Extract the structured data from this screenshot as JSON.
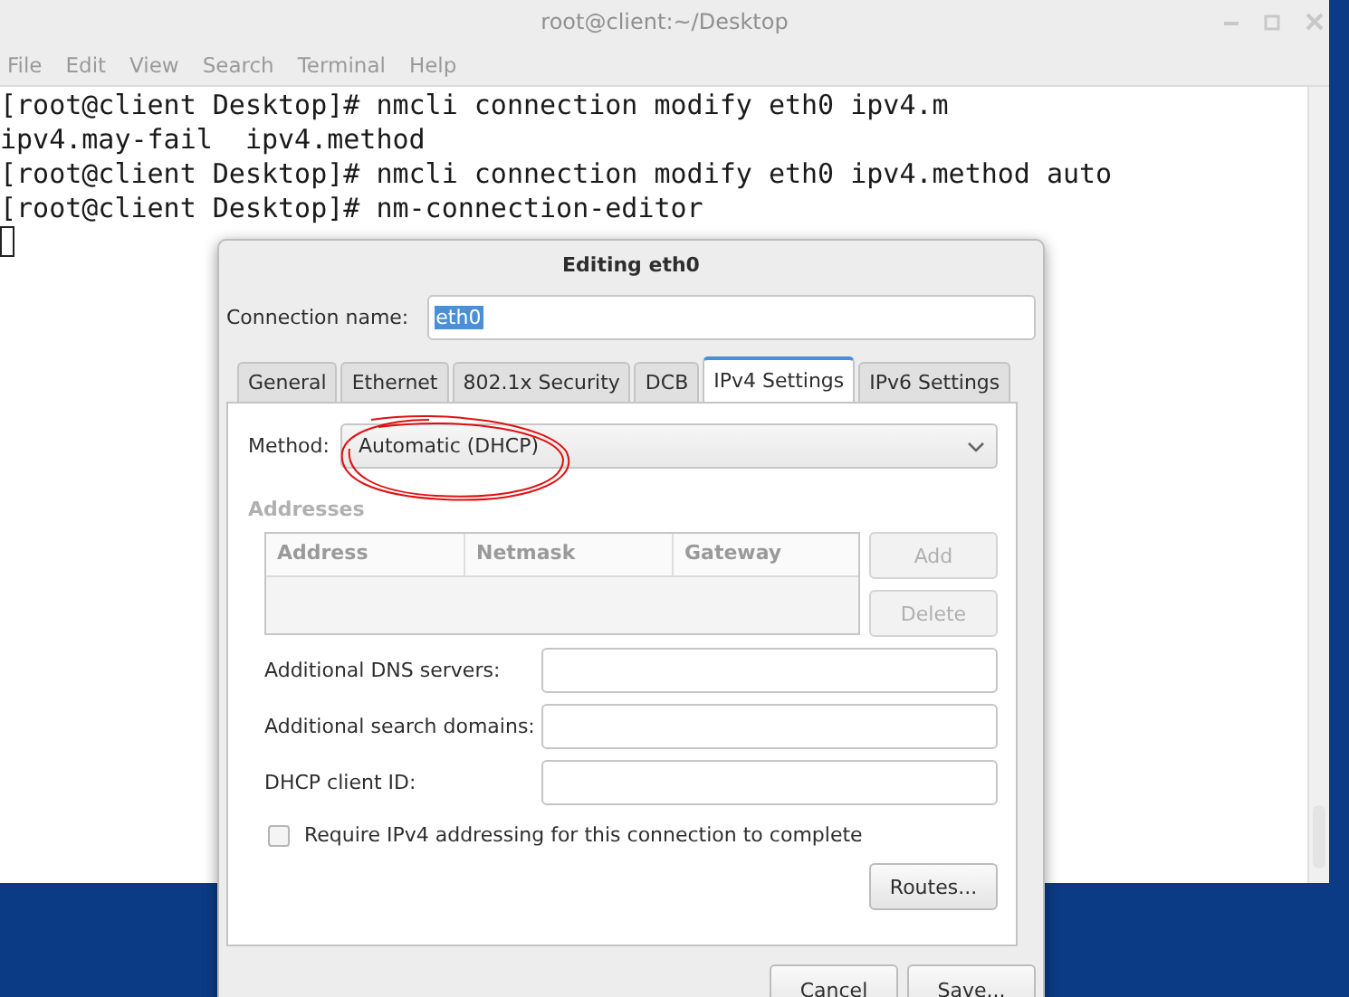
{
  "terminal": {
    "title": "root@client:~/Desktop",
    "menu": [
      "File",
      "Edit",
      "View",
      "Search",
      "Terminal",
      "Help"
    ],
    "lines": [
      "[root@client Desktop]# nmcli connection modify eth0 ipv4.m",
      "ipv4.may-fail  ipv4.method",
      "[root@client Desktop]# nmcli connection modify eth0 ipv4.method auto",
      "[root@client Desktop]# nm-connection-editor"
    ]
  },
  "dialog": {
    "title": "Editing eth0",
    "connection_name": {
      "label": "Connection name:",
      "value": "eth0",
      "text_selected": true
    },
    "tabs": [
      {
        "label": "General",
        "selected": false
      },
      {
        "label": "Ethernet",
        "selected": false
      },
      {
        "label": "802.1x Security",
        "selected": false
      },
      {
        "label": "DCB",
        "selected": false
      },
      {
        "label": "IPv4 Settings",
        "selected": true
      },
      {
        "label": "IPv6 Settings",
        "selected": false
      }
    ],
    "method": {
      "label": "Method:",
      "value": "Automatic (DHCP)",
      "annotated": true
    },
    "addresses": {
      "label": "Addresses",
      "disabled": true,
      "columns": [
        "Address",
        "Netmask",
        "Gateway"
      ],
      "buttons": [
        {
          "label": "Add",
          "disabled": true
        },
        {
          "label": "Delete",
          "disabled": true
        }
      ]
    },
    "fields": [
      {
        "label": "Additional DNS servers:"
      },
      {
        "label": "Additional search domains:"
      },
      {
        "label": "DHCP client ID:"
      }
    ],
    "require": {
      "label": "Require IPv4 addressing for this connection to complete",
      "checked": false
    },
    "routes_button": "Routes...",
    "buttons": [
      "Cancel",
      "Save..."
    ]
  }
}
